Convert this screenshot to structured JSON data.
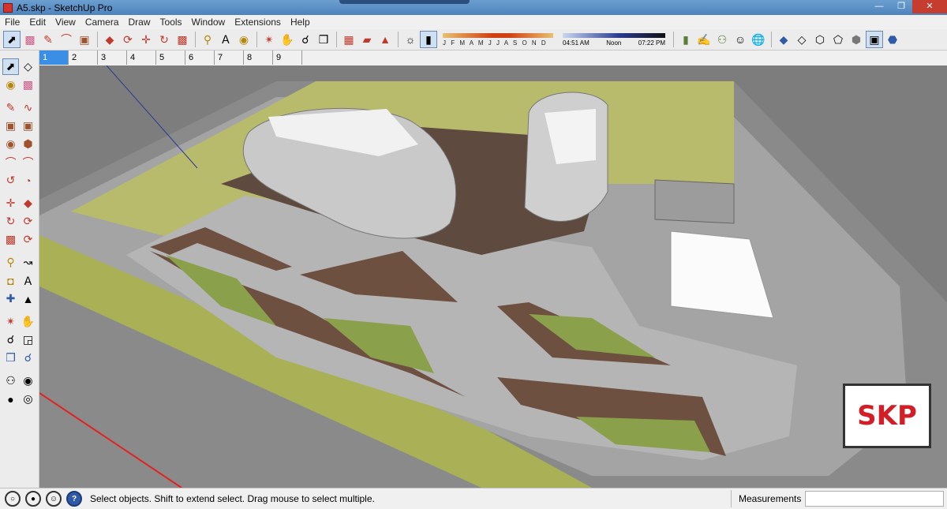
{
  "window": {
    "title": "A5.skp - SketchUp Pro"
  },
  "menu": [
    "File",
    "Edit",
    "View",
    "Camera",
    "Draw",
    "Tools",
    "Window",
    "Extensions",
    "Help"
  ],
  "shadow_months": "J F M A M J J A S O N D",
  "time": {
    "start": "04:51 AM",
    "mid": "Noon",
    "end": "07:22 PM"
  },
  "scenes": [
    "1",
    "2",
    "3",
    "4",
    "5",
    "6",
    "7",
    "8",
    "9"
  ],
  "active_scene": "1",
  "status": {
    "hint": "Select objects. Shift to extend select. Drag mouse to select multiple.",
    "measurements_label": "Measurements",
    "measurements_value": ""
  },
  "badge": {
    "text": "SKP"
  },
  "colors": {
    "skp_red": "#d21f27",
    "scene_active": "#3a8ee6",
    "titlebar": "#4d83bd"
  }
}
